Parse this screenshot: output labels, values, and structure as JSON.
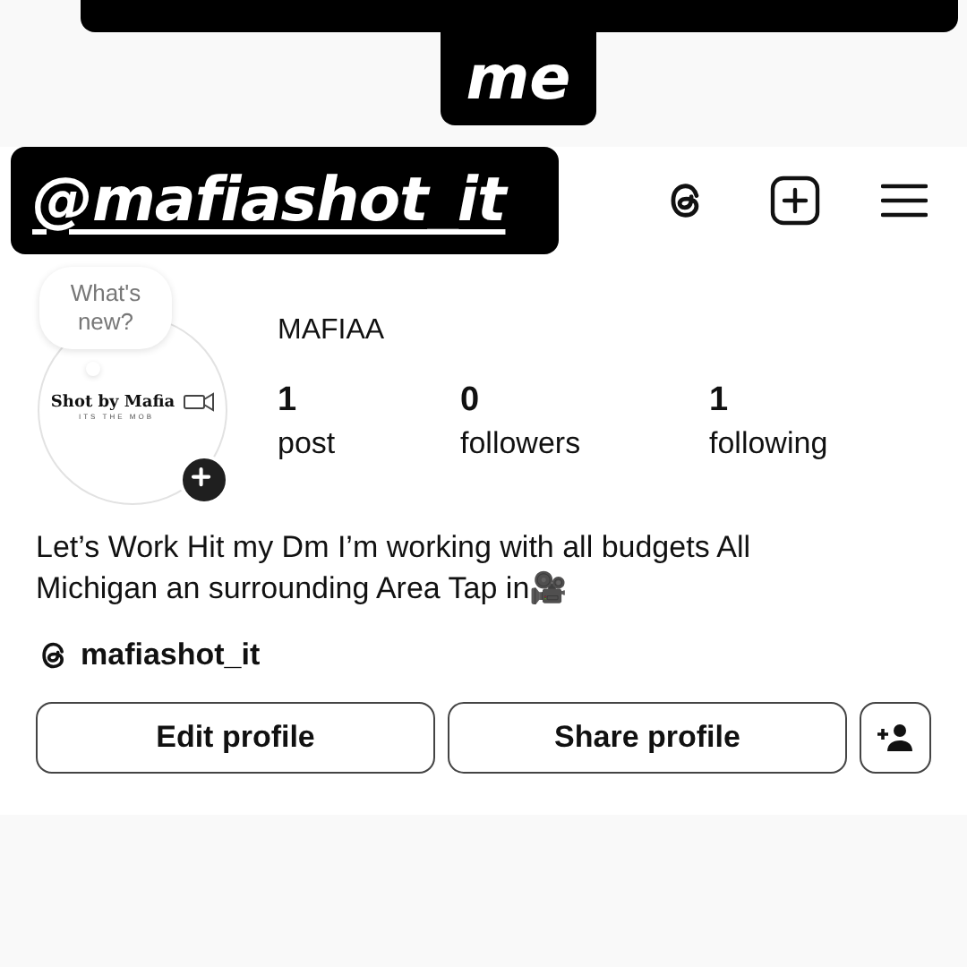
{
  "caption_sticker": {
    "visible_line": "me"
  },
  "handle_sticker": {
    "text": "@mafiashot_it"
  },
  "profile": {
    "bubble": "What's new?",
    "logo_title": "Shot by Mafia",
    "logo_tagline": "ITS THE MOB",
    "name": "MAFIAA",
    "stats": [
      {
        "value": "1",
        "label": "post"
      },
      {
        "value": "0",
        "label": "followers"
      },
      {
        "value": "1",
        "label": "following"
      }
    ],
    "bio": "Let’s Work Hit my Dm I’m working with all budgets All Michigan an surrounding Area Tap in🎥",
    "threads_handle": "mafiashot_it",
    "buttons": [
      "Edit profile",
      "Share profile"
    ]
  }
}
